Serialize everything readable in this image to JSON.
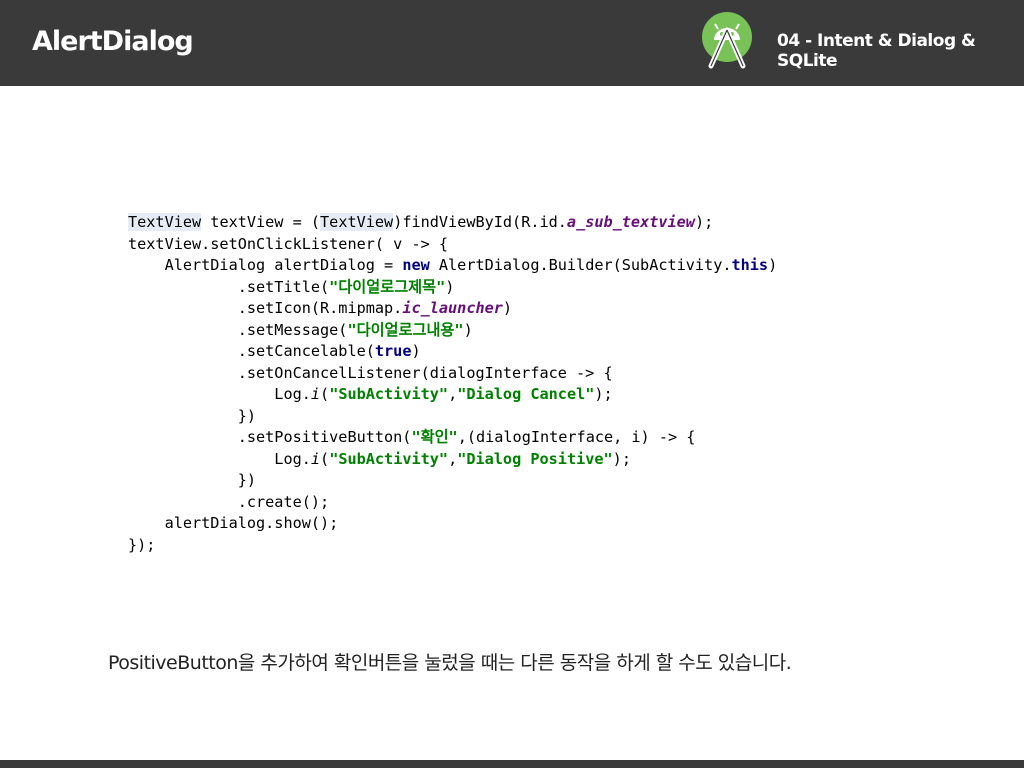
{
  "header": {
    "title": "AlertDialog",
    "chapter": "04 - Intent & Dialog & SQLite",
    "logo_icon": "android-studio-icon",
    "colors": {
      "bar": "#3a3a3a",
      "logo_green": "#78c257"
    }
  },
  "code": {
    "lines": [
      [
        "TextView",
        " textView = (",
        "TextView",
        ")findViewById(R.id.",
        "a_sub_textview",
        ");"
      ],
      [
        "textView.setOnClickListener( v -> {"
      ],
      [
        "    AlertDialog alertDialog = ",
        "new",
        " AlertDialog.Builder(SubActivity.",
        "this",
        ")"
      ],
      [
        "            .setTitle(",
        "\"다이얼로그제목\"",
        ")"
      ],
      [
        "            .setIcon(R.mipmap.",
        "ic_launcher",
        ")"
      ],
      [
        "            .setMessage(",
        "\"다이얼로그내용\"",
        ")"
      ],
      [
        "            .setCancelable(",
        "true",
        ")"
      ],
      [
        "            .setOnCancelListener(dialogInterface -> {"
      ],
      [
        "                Log.",
        "i",
        "(",
        "\"SubActivity\"",
        ",",
        "\"Dialog Cancel\"",
        ");"
      ],
      [
        "            })"
      ],
      [
        "            .setPositiveButton(",
        "\"확인\"",
        ",(dialogInterface, i) -> {"
      ],
      [
        "                Log.",
        "i",
        "(",
        "\"SubActivity\"",
        ",",
        "\"Dialog Positive\"",
        ");"
      ],
      [
        "            })"
      ],
      [
        "            .create();"
      ],
      [
        "    alertDialog.show();"
      ],
      [
        "});"
      ]
    ],
    "colors": {
      "keyword": "#000080",
      "field": "#660e7a",
      "string": "#008000",
      "highlight": "#e6ecf5"
    }
  },
  "caption": "PositiveButton을 추가하여 확인버튼을 눌렀을 때는 다른 동작을 하게 할 수도 있습니다."
}
